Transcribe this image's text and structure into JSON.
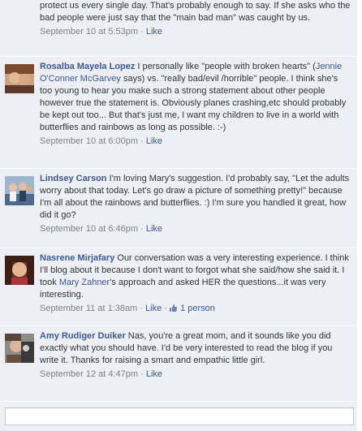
{
  "thread": {
    "comments": [
      {
        "text_tail": "protect us every single day. That's probably enough to say. If she asks who the bad people were just say that the \"main bad man\" was caught by us.",
        "timestamp": "September 10 at 5:53pm",
        "like": "Like"
      },
      {
        "author": "Rosalba Mayela Lopez",
        "text_1": " I personally like \"people with broken hearts\" (",
        "mention": "Jennie O'Conner McGarvey",
        "text_2": " says) vs. \"really bad/evil /horrible\" people. I think she's too young to hear you make such a strong statement about other people however true the statement is. Obviously planes crashing,etc should probably be kept out too... But that's just me, I want my children to live in a world with butterflies and rainbows as long as possible. :-)",
        "timestamp": "September 10 at 6:00pm",
        "like": "Like"
      },
      {
        "author": "Lindsey Carson",
        "text": " I'm loving Mary's suggestion. I'd probably say, \"Let the adults worry about that today. Let's go draw a picture of something pretty!\" because I'm all about the rainbows and butterflies. :) I'm sure you handled it great, how did it go?",
        "timestamp": "September 10 at 6:46pm",
        "like": "Like"
      },
      {
        "author": "Nasrene Mirjafary",
        "text_1": " Our conversation was a very interesting experience. I think I'll blog about it because I don't want to forgot what she said/how she said it. I took ",
        "mention": "Mary Zahner",
        "text_2": "'s approach and asked HER the questions...it was very interesting.",
        "timestamp": "September 11 at 1:38am",
        "like": "Like",
        "likes_count": "1 person"
      },
      {
        "author": "Amy Rudiger Duiker",
        "text": " Nas, you're a great mom, and it sounds like you did exactly what you should have. I'd be very interested to read the blog if you write it. Thanks for raising a smart and empathic little girl.",
        "timestamp": "September 12 at 4:47pm",
        "like": "Like"
      }
    ],
    "separator": "·"
  },
  "colors": {
    "link": "#3b5998",
    "timestamp": "#808080",
    "comment_bg": "#edeff4"
  },
  "icons": {
    "thumbs_up": "thumbs-up-icon"
  }
}
